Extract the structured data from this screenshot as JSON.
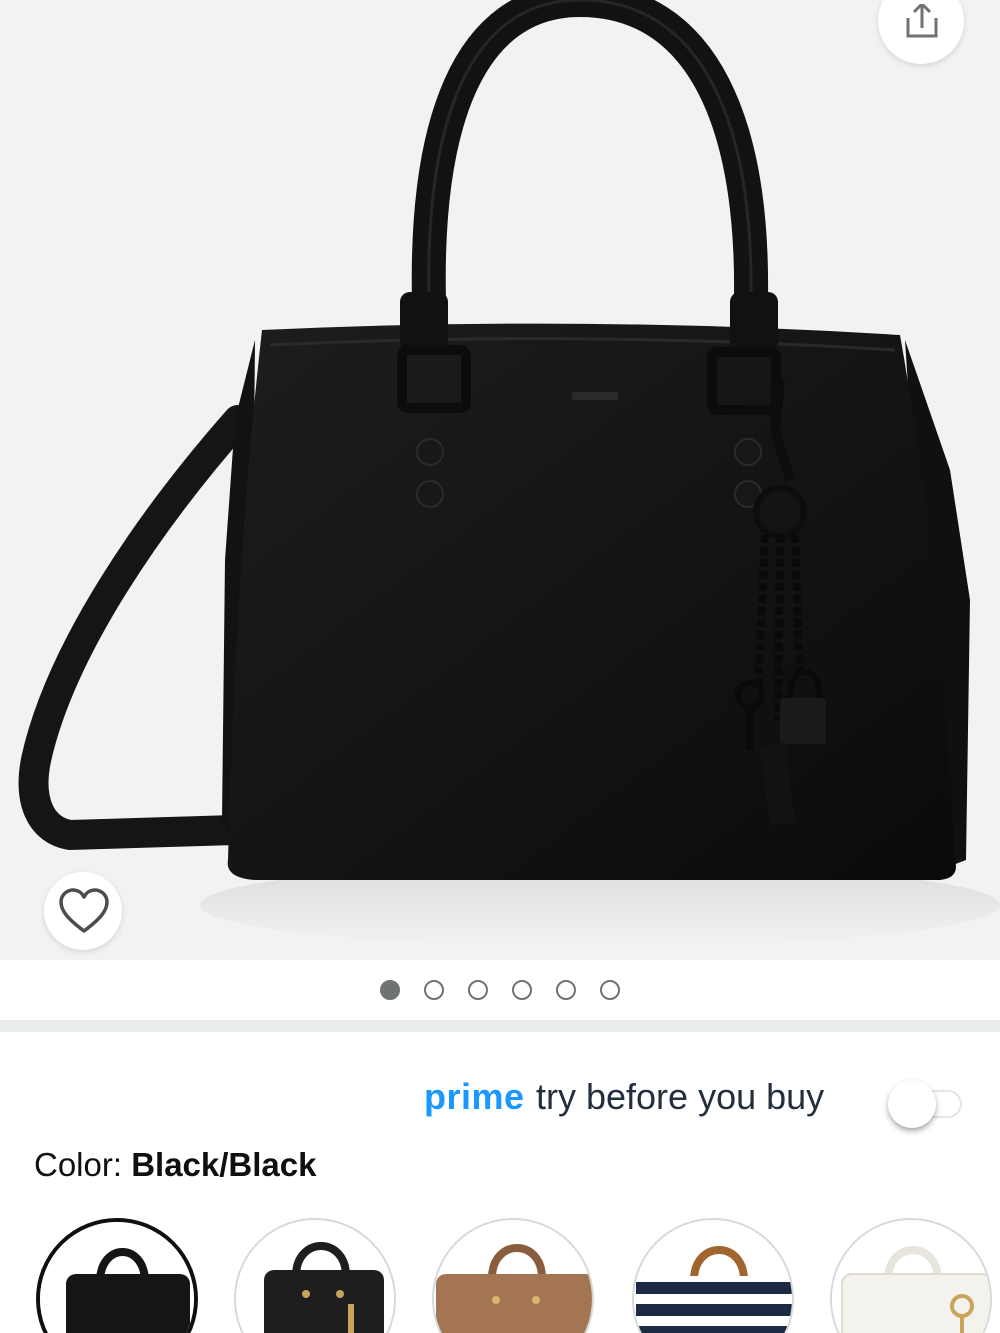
{
  "product": {
    "image_count": 6,
    "active_image_index": 0
  },
  "prime": {
    "brand": "prime",
    "text": "try before you buy",
    "toggle_on": false,
    "brand_color": "#1a98ff"
  },
  "color": {
    "label": "Color: ",
    "value": "Black/Black"
  },
  "swatches": [
    {
      "name": "black-black",
      "color": "#151515",
      "selected": true
    },
    {
      "name": "black-gold",
      "color": "#1e1e1e",
      "selected": false
    },
    {
      "name": "cognac",
      "color": "#a47553",
      "selected": false
    },
    {
      "name": "navy-stripe",
      "color": "#1d2a44",
      "selected": false
    },
    {
      "name": "white",
      "color": "#f4f2ec",
      "selected": false
    }
  ],
  "icons": {
    "share": "share-icon",
    "wishlist": "heart-icon"
  }
}
